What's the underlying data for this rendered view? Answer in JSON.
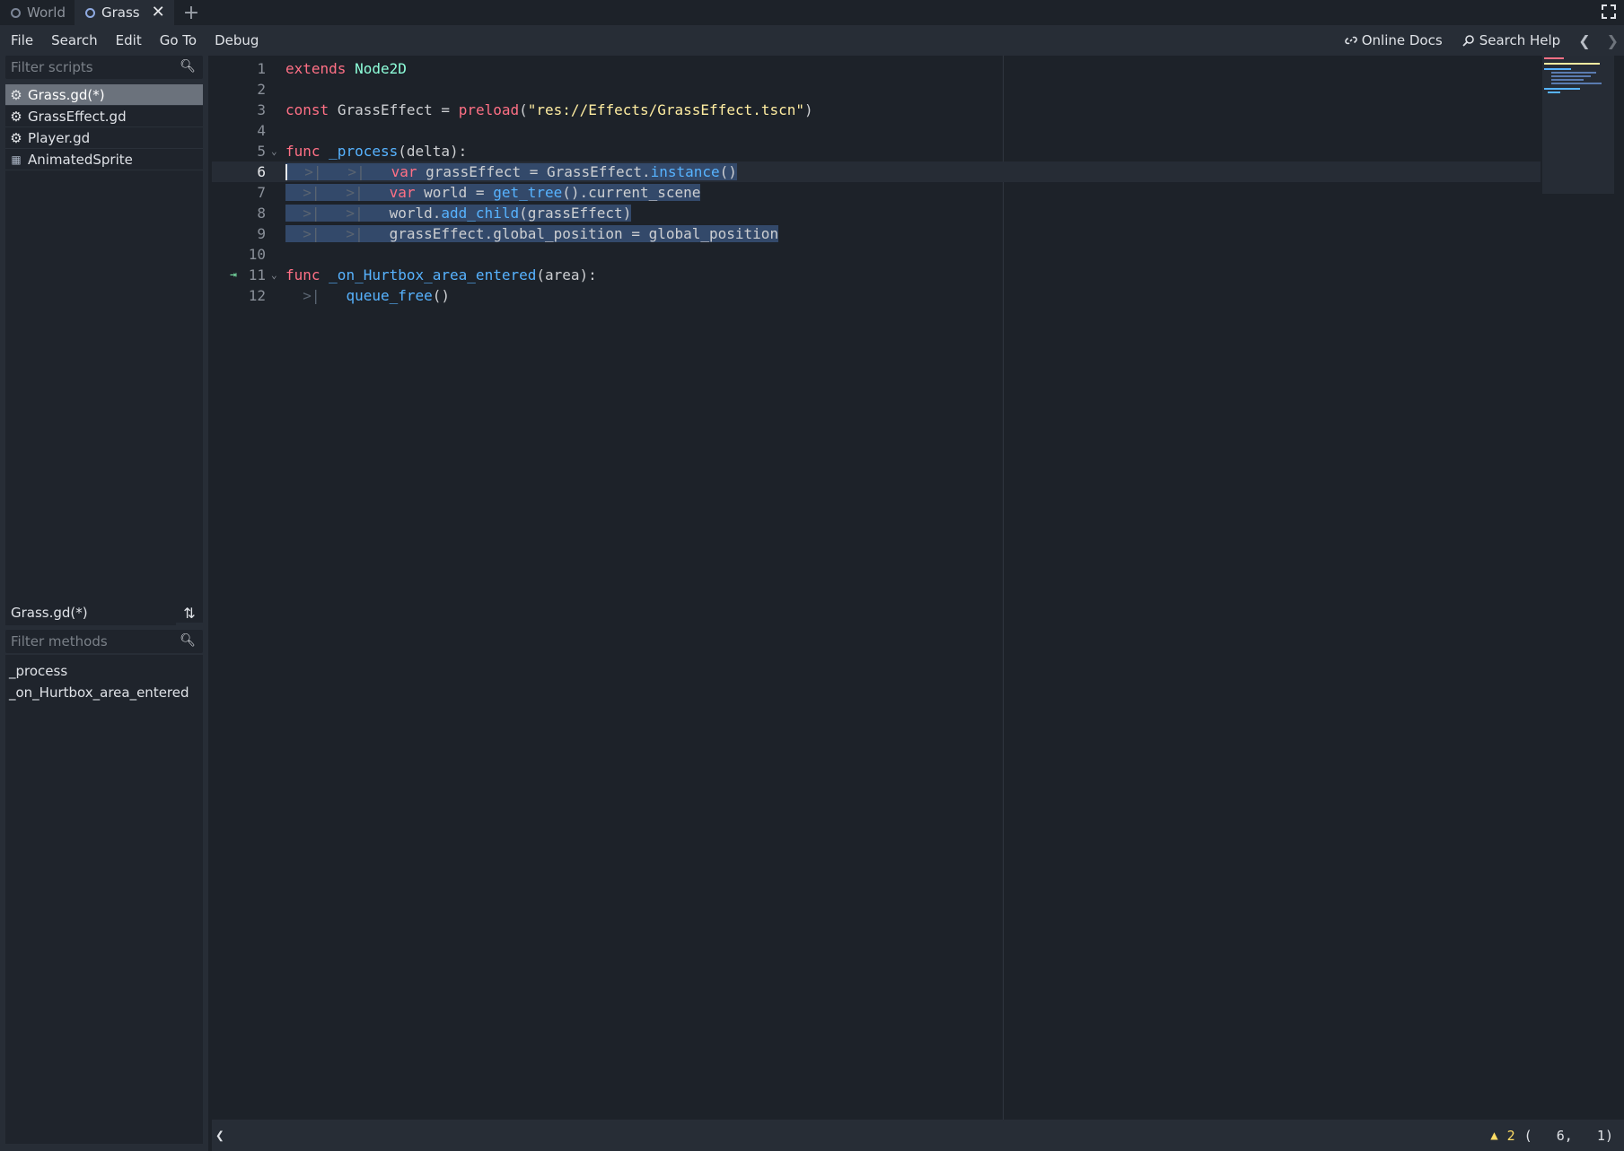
{
  "tabs": [
    {
      "label": "World",
      "active": false
    },
    {
      "label": "Grass",
      "active": true
    }
  ],
  "tab_close": "✕",
  "tab_add": "+",
  "menu": [
    "File",
    "Search",
    "Edit",
    "Go To",
    "Debug"
  ],
  "toolbar": {
    "online_docs": "Online Docs",
    "search_help": "Search Help"
  },
  "scripts_panel": {
    "filter_placeholder": "Filter scripts",
    "items": [
      {
        "label": "Grass.gd(*)",
        "icon": "gear-icon",
        "selected": true
      },
      {
        "label": "GrassEffect.gd",
        "icon": "gear-icon",
        "selected": false
      },
      {
        "label": "Player.gd",
        "icon": "gear-icon",
        "selected": false
      },
      {
        "label": "AnimatedSprite",
        "icon": "animated-sprite-icon",
        "selected": false
      }
    ]
  },
  "methods_panel": {
    "current_script": "Grass.gd(*)",
    "filter_placeholder": "Filter methods",
    "items": [
      "_process",
      "_on_Hurtbox_area_entered"
    ]
  },
  "editor": {
    "line_numbers": [
      "1",
      "2",
      "3",
      "4",
      "5",
      "6",
      "7",
      "8",
      "9",
      "10",
      "11",
      "12"
    ],
    "current_line": 6,
    "selected_lines": [
      6,
      7,
      8,
      9
    ],
    "line1": {
      "kw": "extends",
      "cls": "Node2D"
    },
    "line3": {
      "kw": "const",
      "name": "GrassEffect",
      "eq": " = ",
      "fn": "preload",
      "str": "\"res://Effects/GrassEffect.tscn\"",
      "paren_open": "(",
      "paren_close": ")"
    },
    "line5": {
      "kw": "func",
      "fn": "_process",
      "args": "(delta):"
    },
    "line6": {
      "kw": "var",
      "name": " grassEffect = GrassEffect.",
      "fn": "instance",
      "tail": "()"
    },
    "line7": {
      "kw": "var",
      "name": " world = ",
      "fn": "get_tree",
      "tail": "().current_scene"
    },
    "line8": {
      "name": "world.",
      "fn": "add_child",
      "tail": "(grassEffect)"
    },
    "line9": {
      "name": "grassEffect.global_position = global_position"
    },
    "line11": {
      "kw": "func",
      "fn": "_on_Hurtbox_area_entered",
      "args": "(area):"
    },
    "line12": {
      "fn": "queue_free",
      "tail": "()"
    }
  },
  "status": {
    "warnings": "2",
    "position": "(   6,   1)"
  },
  "colors": {
    "keyword": "#ff7085",
    "class": "#8effda",
    "string": "#ffeda1",
    "function": "#57b3ff",
    "selection": "#33496a",
    "warning": "#ffdd65"
  }
}
